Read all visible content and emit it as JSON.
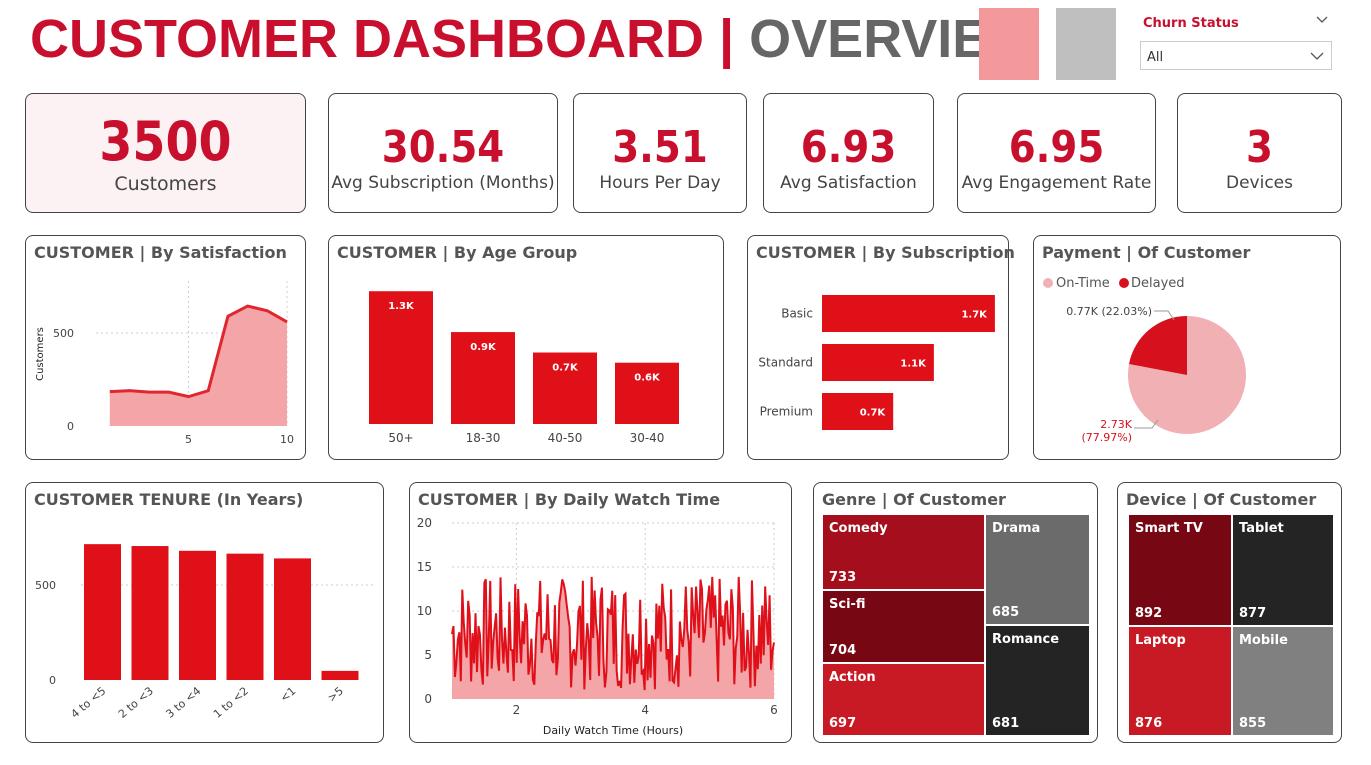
{
  "header": {
    "title_main": "CUSTOMER DASHBOARD",
    "title_sep": " | ",
    "title_sub": "OVERVIEW",
    "colors": {
      "accent": "#c8102e",
      "swatch_churn": "#f4999b",
      "swatch_no": "#bfbfbf"
    }
  },
  "slicer": {
    "label": "Churn Status",
    "value": "All"
  },
  "kpis": [
    {
      "value": "3500",
      "label": "Customers"
    },
    {
      "value": "30.54",
      "label": "Avg Subscription (Months)"
    },
    {
      "value": "3.51",
      "label": "Hours Per Day"
    },
    {
      "value": "6.93",
      "label": "Avg Satisfaction"
    },
    {
      "value": "6.95",
      "label": "Avg Engagement Rate"
    },
    {
      "value": "3",
      "label": "Devices"
    }
  ],
  "visual_titles": {
    "satisfaction": "CUSTOMER | By Satisfaction",
    "age": "CUSTOMER | By Age Group",
    "subscription": "CUSTOMER | By Subscription",
    "payment": "Payment | Of Customer",
    "tenure": "CUSTOMER TENURE (In Years)",
    "watch": "CUSTOMER | By Daily Watch Time",
    "genre": "Genre | Of Customer",
    "device": "Device | Of Customer"
  },
  "chart_data": [
    {
      "id": "satisfaction",
      "type": "area",
      "x": [
        1,
        2,
        3,
        4,
        5,
        6,
        7,
        8,
        9,
        10
      ],
      "values": [
        185,
        190,
        182,
        182,
        158,
        190,
        590,
        645,
        620,
        560
      ],
      "ylabel": "Customers",
      "y_ticks": [
        "0",
        "500"
      ],
      "x_ticks": [
        "5",
        "10"
      ],
      "xlim": [
        0.3,
        10
      ],
      "ylim": [
        0,
        780
      ],
      "grid": true
    },
    {
      "id": "age",
      "type": "bar",
      "categories": [
        "50+",
        "18-30",
        "40-50",
        "30-40"
      ],
      "values": [
        1.3,
        0.9,
        0.7,
        0.6
      ],
      "labels": [
        "1.3K",
        "0.9K",
        "0.7K",
        "0.6K"
      ],
      "ylim": [
        0,
        1.4
      ]
    },
    {
      "id": "subscription",
      "type": "bar",
      "orientation": "horizontal",
      "categories": [
        "Basic",
        "Standard",
        "Premium"
      ],
      "values": [
        1.7,
        1.1,
        0.7
      ],
      "labels": [
        "1.7K",
        "1.1K",
        "0.7K"
      ],
      "xlim": [
        0,
        1.75
      ]
    },
    {
      "id": "payment",
      "type": "pie",
      "categories": [
        "On-Time",
        "Delayed"
      ],
      "values": [
        2.73,
        0.77
      ],
      "labels": [
        "2.73K\n(77.97%)",
        "0.77K (22.03%)"
      ],
      "legend": "top-left",
      "colors": [
        "#f1b0b4",
        "#d6101c"
      ]
    },
    {
      "id": "tenure",
      "type": "bar",
      "categories": [
        "4 to <5",
        "2 to <3",
        "3 to <4",
        "1 to <2",
        "<1",
        ">5"
      ],
      "values": [
        715,
        705,
        680,
        665,
        640,
        48
      ],
      "y_ticks": [
        "0",
        "500"
      ],
      "ylim": [
        0,
        800
      ],
      "grid": true
    },
    {
      "id": "watch",
      "type": "area",
      "xlabel": "Daily Watch Time (Hours)",
      "x_ticks": [
        "2",
        "4",
        "6"
      ],
      "y_ticks": [
        "0",
        "5",
        "10",
        "15",
        "20"
      ],
      "xlim": [
        1,
        6
      ],
      "ylim": [
        0,
        20
      ],
      "grid": true,
      "values_range": [
        1,
        14
      ]
    },
    {
      "id": "genre",
      "type": "treemap",
      "categories": [
        "Comedy",
        "Sci-fi",
        "Action",
        "Drama",
        "Romance"
      ],
      "values": [
        733,
        704,
        697,
        685,
        681
      ],
      "colors": [
        "#a50f1d",
        "#780714",
        "#c81a24",
        "#6b6b6b",
        "#242424"
      ]
    },
    {
      "id": "device",
      "type": "treemap",
      "categories": [
        "Smart TV",
        "Tablet",
        "Laptop",
        "Mobile"
      ],
      "values": [
        892,
        877,
        876,
        855
      ],
      "colors": [
        "#780714",
        "#242424",
        "#c81a24",
        "#808080"
      ]
    }
  ]
}
